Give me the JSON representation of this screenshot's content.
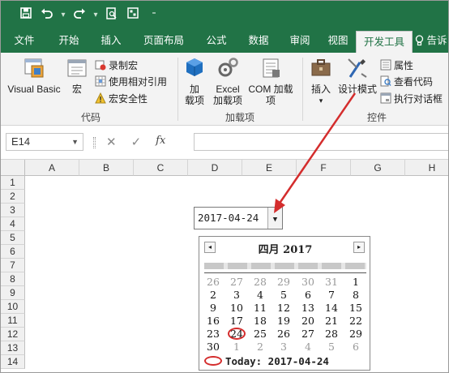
{
  "qat": {
    "save_icon": "save-icon",
    "undo_icon": "undo-icon",
    "redo_icon": "redo-icon",
    "preview_icon": "print-preview-icon",
    "form_icon": "form-icon",
    "more_icon": "more-icon"
  },
  "tabs": [
    "文件",
    "开始",
    "插入",
    "页面布局",
    "公式",
    "数据",
    "审阅",
    "视图",
    "开发工具"
  ],
  "tell_me": "告诉",
  "ribbon": {
    "code": {
      "label": "代码",
      "visual_basic": "Visual Basic",
      "macro": "宏",
      "record_macro": "录制宏",
      "relative_ref": "使用相对引用",
      "macro_security": "宏安全性"
    },
    "addins": {
      "label": "加载项",
      "addins_1": "加",
      "addins_2": "载项",
      "excel_1": "Excel",
      "excel_2": "加载项",
      "com": "COM 加载项"
    },
    "controls": {
      "label": "控件",
      "insert": "插入",
      "insert_arrow": "▾",
      "design_mode": "设计模式",
      "properties": "属性",
      "view_code": "查看代码",
      "run_dialog": "执行对话框"
    }
  },
  "formula_bar": {
    "namebox": "E14",
    "cancel": "✕",
    "enter": "✓",
    "fx": "fx"
  },
  "columns": [
    "A",
    "B",
    "C",
    "D",
    "E",
    "F",
    "G",
    "H"
  ],
  "rows": [
    "1",
    "2",
    "3",
    "4",
    "5",
    "6",
    "7",
    "8",
    "9",
    "10",
    "11",
    "12",
    "13",
    "14"
  ],
  "date_picker": {
    "value": "2017-04-24",
    "dropdown": "▼"
  },
  "calendar": {
    "prev": "◂",
    "next": "▸",
    "title": "四月  2017",
    "weeks": [
      [
        {
          "d": "26",
          "m": true
        },
        {
          "d": "27",
          "m": true
        },
        {
          "d": "28",
          "m": true
        },
        {
          "d": "29",
          "m": true
        },
        {
          "d": "30",
          "m": true
        },
        {
          "d": "31",
          "m": true
        },
        {
          "d": "1",
          "m": false
        }
      ],
      [
        {
          "d": "2",
          "m": false
        },
        {
          "d": "3",
          "m": false
        },
        {
          "d": "4",
          "m": false
        },
        {
          "d": "5",
          "m": false
        },
        {
          "d": "6",
          "m": false
        },
        {
          "d": "7",
          "m": false
        },
        {
          "d": "8",
          "m": false
        }
      ],
      [
        {
          "d": "9",
          "m": false
        },
        {
          "d": "10",
          "m": false
        },
        {
          "d": "11",
          "m": false
        },
        {
          "d": "12",
          "m": false
        },
        {
          "d": "13",
          "m": false
        },
        {
          "d": "14",
          "m": false
        },
        {
          "d": "15",
          "m": false
        }
      ],
      [
        {
          "d": "16",
          "m": false
        },
        {
          "d": "17",
          "m": false
        },
        {
          "d": "18",
          "m": false
        },
        {
          "d": "19",
          "m": false
        },
        {
          "d": "20",
          "m": false
        },
        {
          "d": "21",
          "m": false
        },
        {
          "d": "22",
          "m": false
        }
      ],
      [
        {
          "d": "23",
          "m": false
        },
        {
          "d": "24",
          "m": false
        },
        {
          "d": "25",
          "m": false
        },
        {
          "d": "26",
          "m": false
        },
        {
          "d": "27",
          "m": false
        },
        {
          "d": "28",
          "m": false
        },
        {
          "d": "29",
          "m": false
        }
      ],
      [
        {
          "d": "30",
          "m": false
        },
        {
          "d": "1",
          "m": true
        },
        {
          "d": "2",
          "m": true
        },
        {
          "d": "3",
          "m": true
        },
        {
          "d": "4",
          "m": true
        },
        {
          "d": "5",
          "m": true
        },
        {
          "d": "6",
          "m": true
        }
      ]
    ],
    "today_label": "Today:  2017-04-24",
    "selected_day": "24"
  },
  "colors": {
    "accent": "#217346",
    "annotation": "#d42d2d"
  }
}
